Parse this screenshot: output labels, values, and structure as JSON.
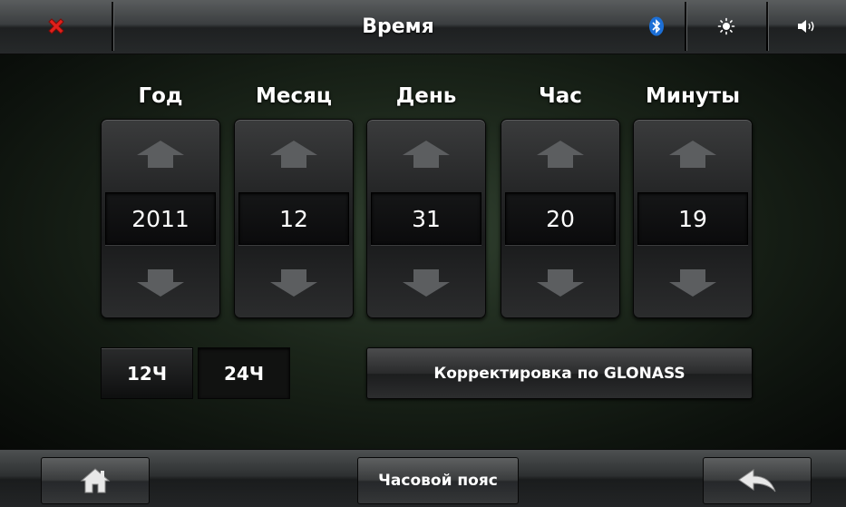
{
  "header": {
    "title": "Время",
    "icons": [
      "close-icon",
      "bluetooth-icon",
      "brightness-icon",
      "volume-icon"
    ]
  },
  "columns": [
    {
      "label": "Год",
      "value": "2011"
    },
    {
      "label": "Месяц",
      "value": "12"
    },
    {
      "label": "День",
      "value": "31"
    },
    {
      "label": "Час",
      "value": "20"
    },
    {
      "label": "Минуты",
      "value": "19"
    }
  ],
  "time_format": {
    "mode_12": "12Ч",
    "mode_24": "24Ч",
    "selected": "12Ч"
  },
  "glonass_button": "Корректировка по GLONASS",
  "footer": {
    "timezone_button": "Часовой пояс",
    "icons": [
      "home-icon",
      "back-icon"
    ]
  },
  "colors": {
    "close_red": "#e0201b",
    "bluetooth_blue": "#1c6fd6",
    "arrow_gray": "#5c5e60"
  }
}
